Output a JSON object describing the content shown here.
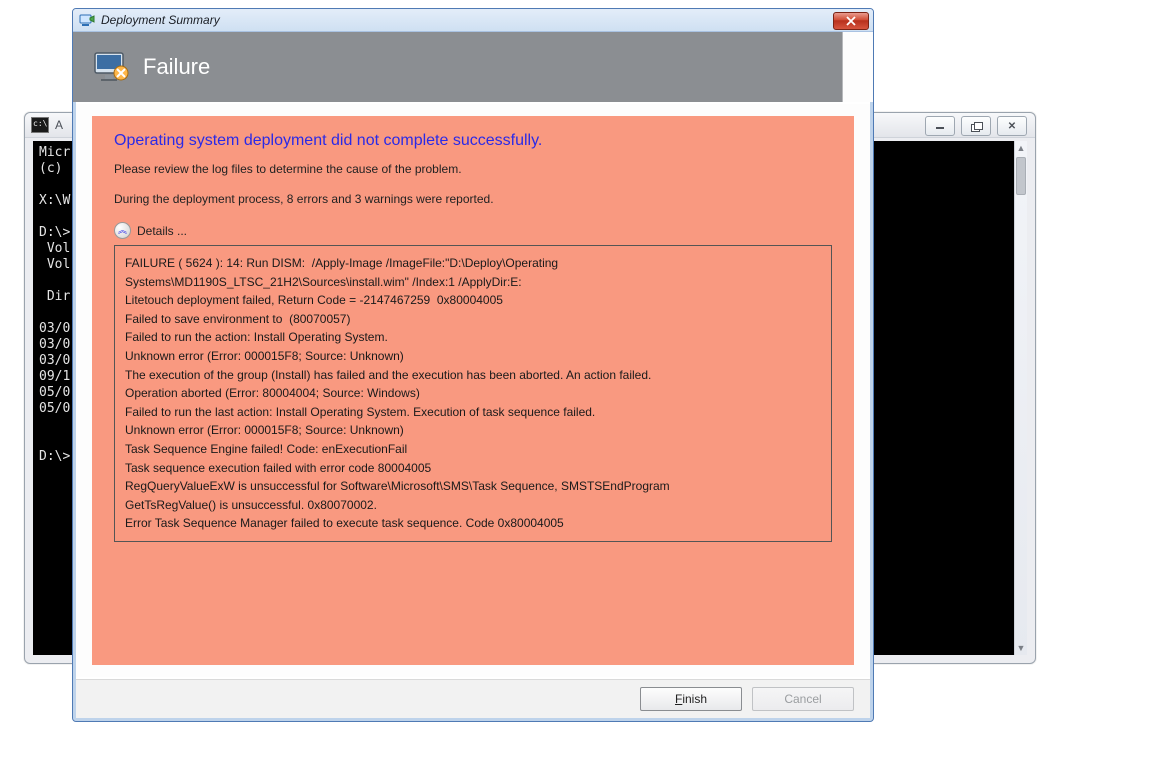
{
  "console": {
    "title_fragment": "A",
    "lines": [
      "Micr",
      "(c) ",
      "",
      "X:\\W",
      "",
      "D:\\>",
      " Vol",
      " Vol",
      "",
      " Dir",
      "",
      "03/0",
      "03/0",
      "03/0",
      "09/1",
      "05/0",
      "05/0",
      "",
      "",
      "D:\\>"
    ],
    "btn_min": "min",
    "btn_max": "max",
    "btn_close": "close"
  },
  "dialog": {
    "title": "Deployment Summary",
    "banner_title": "Failure",
    "headline": "Operating system deployment did not complete successfully.",
    "review_line": "Please review the log files to determine the cause of the problem.",
    "stats_line": "During the deployment process, 8 errors and 3 warnings were reported.",
    "details_label": "Details ...",
    "log": "FAILURE ( 5624 ): 14: Run DISM:  /Apply-Image /ImageFile:\"D:\\Deploy\\Operating Systems\\MD1190S_LTSC_21H2\\Sources\\install.wim\" /Index:1 /ApplyDir:E:\nLitetouch deployment failed, Return Code = -2147467259  0x80004005\nFailed to save environment to  (80070057)\nFailed to run the action: Install Operating System.\nUnknown error (Error: 000015F8; Source: Unknown)\nThe execution of the group (Install) has failed and the execution has been aborted. An action failed.\nOperation aborted (Error: 80004004; Source: Windows)\nFailed to run the last action: Install Operating System. Execution of task sequence failed.\nUnknown error (Error: 000015F8; Source: Unknown)\nTask Sequence Engine failed! Code: enExecutionFail\nTask sequence execution failed with error code 80004005\nRegQueryValueExW is unsuccessful for Software\\Microsoft\\SMS\\Task Sequence, SMSTSEndProgram\nGetTsRegValue() is unsuccessful. 0x80070002.\nError Task Sequence Manager failed to execute task sequence. Code 0x80004005",
    "buttons": {
      "finish": "Finish",
      "cancel": "Cancel"
    }
  }
}
